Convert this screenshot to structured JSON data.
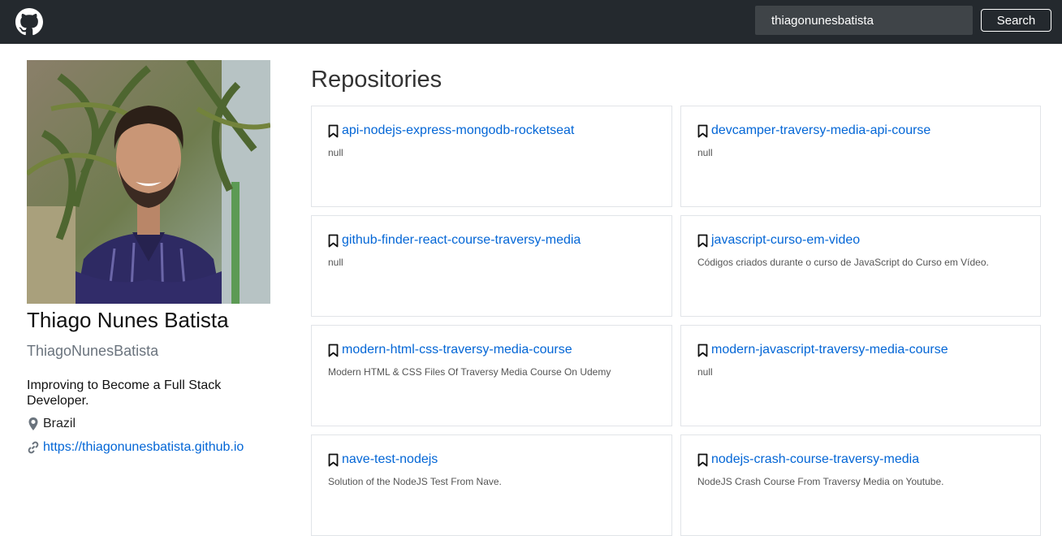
{
  "header": {
    "logo_icon": "github-icon",
    "search_value": "thiagonunesbatista",
    "search_button_label": "Search"
  },
  "profile": {
    "name": "Thiago Nunes Batista",
    "login": "ThiagoNunesBatista",
    "bio": "Improving to Become a Full Stack Developer.",
    "location": "Brazil",
    "blog": "https://thiagonunesbatista.github.io"
  },
  "repos": {
    "title": "Repositories",
    "items": [
      {
        "name": "api-nodejs-express-mongodb-rocketseat",
        "description": "null"
      },
      {
        "name": "devcamper-traversy-media-api-course",
        "description": "null"
      },
      {
        "name": "github-finder-react-course-traversy-media",
        "description": "null"
      },
      {
        "name": "javascript-curso-em-video",
        "description": "Códigos criados durante o curso de JavaScript do Curso em Vídeo."
      },
      {
        "name": "modern-html-css-traversy-media-course",
        "description": "Modern HTML & CSS Files Of Traversy Media Course On Udemy"
      },
      {
        "name": "modern-javascript-traversy-media-course",
        "description": "null"
      },
      {
        "name": "nave-test-nodejs",
        "description": "Solution of the NodeJS Test From Nave."
      },
      {
        "name": "nodejs-crash-course-traversy-media",
        "description": "NodeJS Crash Course From Traversy Media on Youtube."
      }
    ]
  },
  "colors": {
    "header_bg": "#24292e",
    "link": "#0366d6",
    "card_border": "#e1e4e8"
  }
}
